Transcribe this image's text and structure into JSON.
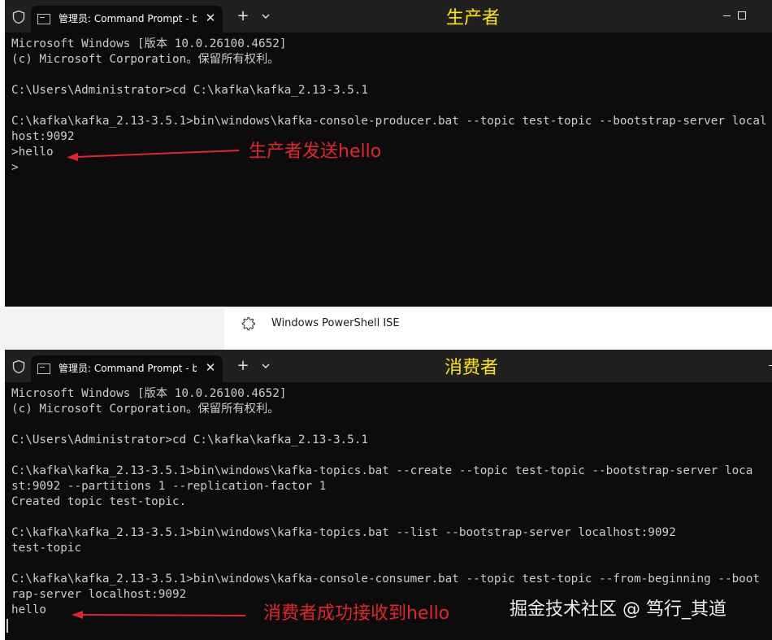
{
  "producer_window": {
    "tab_title": "管理员: Command Prompt - b",
    "label": "生产者",
    "lines": [
      "Microsoft Windows [版本 10.0.26100.4652]",
      "(c) Microsoft Corporation。保留所有权利。",
      "",
      "C:\\Users\\Administrator>cd C:\\kafka\\kafka_2.13-3.5.1",
      "",
      "C:\\kafka\\kafka_2.13-3.5.1>bin\\windows\\kafka-console-producer.bat --topic test-topic --bootstrap-server local",
      "host:9092",
      ">hello",
      ">"
    ],
    "annotation": "生产者发送hello"
  },
  "taskbar_item": {
    "label": "Windows PowerShell ISE",
    "icon": "gear-icon"
  },
  "consumer_window": {
    "tab_title": "管理员: Command Prompt - b",
    "label": "消费者",
    "lines": [
      "Microsoft Windows [版本 10.0.26100.4652]",
      "(c) Microsoft Corporation。保留所有权利。",
      "",
      "C:\\Users\\Administrator>cd C:\\kafka\\kafka_2.13-3.5.1",
      "",
      "C:\\kafka\\kafka_2.13-3.5.1>bin\\windows\\kafka-topics.bat --create --topic test-topic --bootstrap-server loca",
      "st:9092 --partitions 1 --replication-factor 1",
      "Created topic test-topic.",
      "",
      "C:\\kafka\\kafka_2.13-3.5.1>bin\\windows\\kafka-topics.bat --list --bootstrap-server localhost:9092",
      "test-topic",
      "",
      "C:\\kafka\\kafka_2.13-3.5.1>bin\\windows\\kafka-console-consumer.bat --topic test-topic --from-beginning --boot",
      "rap-server localhost:9092",
      "hello"
    ],
    "annotation": "消费者成功接收到hello"
  },
  "watermark": "掘金技术社区 @ 笃行_其道",
  "colors": {
    "terminal_bg": "#0c0c0c",
    "titlebar_bg": "#202020",
    "terminal_text": "#cccccc",
    "label_yellow": "#ffe600",
    "annotation_red": "#e1262b"
  }
}
